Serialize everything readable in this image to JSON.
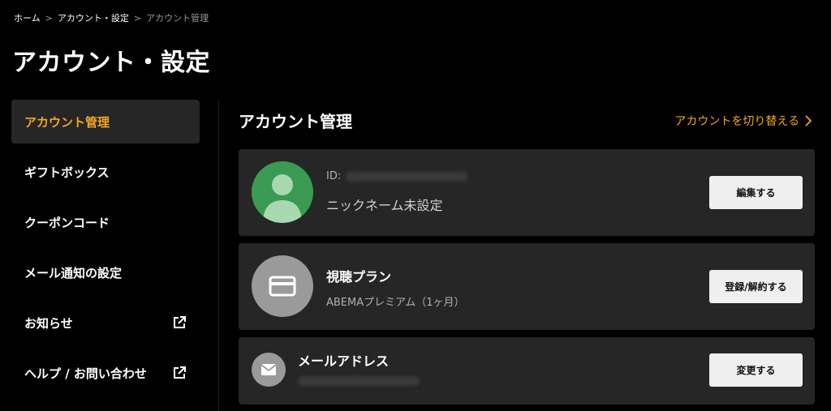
{
  "breadcrumb": {
    "items": [
      "ホーム",
      "アカウント・設定",
      "アカウント管理"
    ]
  },
  "page": {
    "title": "アカウント・設定"
  },
  "sidebar": {
    "items": [
      {
        "label": "アカウント管理",
        "active": true
      },
      {
        "label": "ギフトボックス"
      },
      {
        "label": "クーポンコード"
      },
      {
        "label": "メール通知の設定"
      },
      {
        "label": "お知らせ",
        "icon": "external-link-icon"
      },
      {
        "label": "ヘルプ / お問い合わせ",
        "icon": "external-link-icon"
      }
    ]
  },
  "main": {
    "section_title": "アカウント管理",
    "switch_account_label": "アカウントを切り替える",
    "profile_card": {
      "id_label": "ID:",
      "nickname": "ニックネーム未設定",
      "button_label": "編集する",
      "avatar_color": "#3a9a53",
      "icon": "user-avatar-icon"
    },
    "plan_card": {
      "title": "視聴プラン",
      "subtitle": "ABEMAプレミアム（1ヶ月）",
      "button_label": "登録/解約する",
      "icon": "credit-card-icon"
    },
    "mail_card": {
      "title": "メールアドレス",
      "button_label": "変更する",
      "icon": "mail-icon"
    }
  },
  "colors": {
    "accent": "#f5a623",
    "background": "#000000",
    "card": "#262626"
  }
}
